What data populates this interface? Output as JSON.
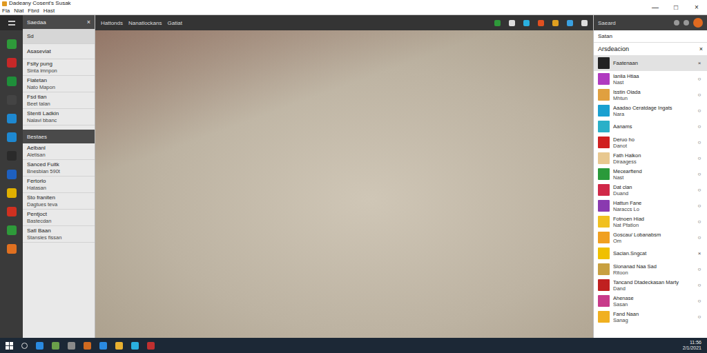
{
  "window": {
    "title": "Dadeany Cosent's Susak",
    "controls": [
      "—",
      "□",
      "×"
    ]
  },
  "menu": [
    "Fla",
    "Niat",
    "Fbrd",
    "Hast"
  ],
  "viewport_toolbar": {
    "tabs": [
      {
        "label": "Hattonds",
        "selected": false
      },
      {
        "label": "Nanatlockans",
        "selected": false
      },
      {
        "label": "Gatiat",
        "selected": false
      }
    ]
  },
  "left_panel": {
    "sections": [
      {
        "title": "Saedaa",
        "close": "×",
        "items": [
          {
            "title": "Sd",
            "subtitle": "",
            "selected": true
          },
          {
            "title": "Asaseviat",
            "subtitle": "",
            "selected": false
          },
          {
            "title": "Fsity pung",
            "subtitle": "Sinta imnpon",
            "selected": false
          },
          {
            "title": "Flatetan",
            "subtitle": "Nato Mapon",
            "selected": false
          },
          {
            "title": "Fsd tlan",
            "subtitle": "Beet talan",
            "selected": false
          },
          {
            "title": "Stenti Ladkin",
            "subtitle": "Nalavi bbanc",
            "selected": false
          }
        ]
      },
      {
        "title": "Bestaes",
        "close": "",
        "items": [
          {
            "title": "Aelbanl",
            "subtitle": "Aletisan",
            "selected": false
          },
          {
            "title": "Sanced Fuitk",
            "subtitle": "Bnesbian 590t",
            "selected": false
          },
          {
            "title": "Fertorlo",
            "subtitle": "Hatasan",
            "selected": false
          },
          {
            "title": "Sto franiten",
            "subtitle": "Dagtues teva",
            "selected": false
          },
          {
            "title": "Pentjoct",
            "subtitle": "Bastecdan",
            "selected": false
          },
          {
            "title": "Satl Baan",
            "subtitle": "Stansies fissan",
            "selected": false
          }
        ]
      }
    ]
  },
  "right_panel": {
    "header": "Saeard",
    "label": "Satan",
    "group": {
      "title": "Arsdeacion",
      "close": "×"
    },
    "items": [
      {
        "title": "Faatenaan",
        "subtitle": "",
        "mark": "×",
        "color": "#222222",
        "selected": true
      },
      {
        "title": "Ianlia Htiaa",
        "subtitle": "Nast",
        "mark": "○",
        "color": "#b03ac0",
        "selected": false
      },
      {
        "title": "Isstin Oiada",
        "subtitle": "Mhtun",
        "mark": "○",
        "color": "#e0a040",
        "selected": false
      },
      {
        "title": "Aaadao Ceratdage Ingats",
        "subtitle": "Nara",
        "mark": "○",
        "color": "#1aa0d0",
        "selected": false
      },
      {
        "title": "Aanams",
        "subtitle": "",
        "mark": "○",
        "color": "#2ab0c8",
        "selected": false
      },
      {
        "title": "Deruo ho",
        "subtitle": "Danot",
        "mark": "○",
        "color": "#d02020",
        "selected": false
      },
      {
        "title": "Fath Halkon",
        "subtitle": "Diraagess",
        "mark": "○",
        "color": "#e8c890",
        "selected": false
      },
      {
        "title": "Mecearftend",
        "subtitle": "Nast",
        "mark": "○",
        "color": "#2a9a3a",
        "selected": false
      },
      {
        "title": "Dat clan",
        "subtitle": "Duand",
        "mark": "○",
        "color": "#d02848",
        "selected": false
      },
      {
        "title": "Hattun Fane",
        "subtitle": "Naraccs Lo",
        "mark": "○",
        "color": "#8a3ab0",
        "selected": false
      },
      {
        "title": "Fotnoen Hiad",
        "subtitle": "Nat Pfatlon",
        "mark": "○",
        "color": "#f0c020",
        "selected": false
      },
      {
        "title": "Goscau/ Lobanabsm",
        "subtitle": "Om",
        "mark": "○",
        "color": "#f0a020",
        "selected": false
      },
      {
        "title": "Sacian.Sngcat",
        "subtitle": "",
        "mark": "×",
        "color": "#f0c000",
        "selected": false
      },
      {
        "title": "Slonanad Naa Sad",
        "subtitle": "Ritoon",
        "mark": "○",
        "color": "#c8a040",
        "selected": false
      },
      {
        "title": "Tancand Dtadeckasan Marty",
        "subtitle": "Dand",
        "mark": "○",
        "color": "#c02020",
        "selected": false
      },
      {
        "title": "Ahenase",
        "subtitle": "Sasan",
        "mark": "○",
        "color": "#c83a8a",
        "selected": false
      },
      {
        "title": "Fand Naan",
        "subtitle": "Sanag",
        "mark": "○",
        "color": "#f0b020",
        "selected": false
      }
    ]
  },
  "taskbar": {
    "time": "11:56",
    "date": "2/1/2021"
  }
}
